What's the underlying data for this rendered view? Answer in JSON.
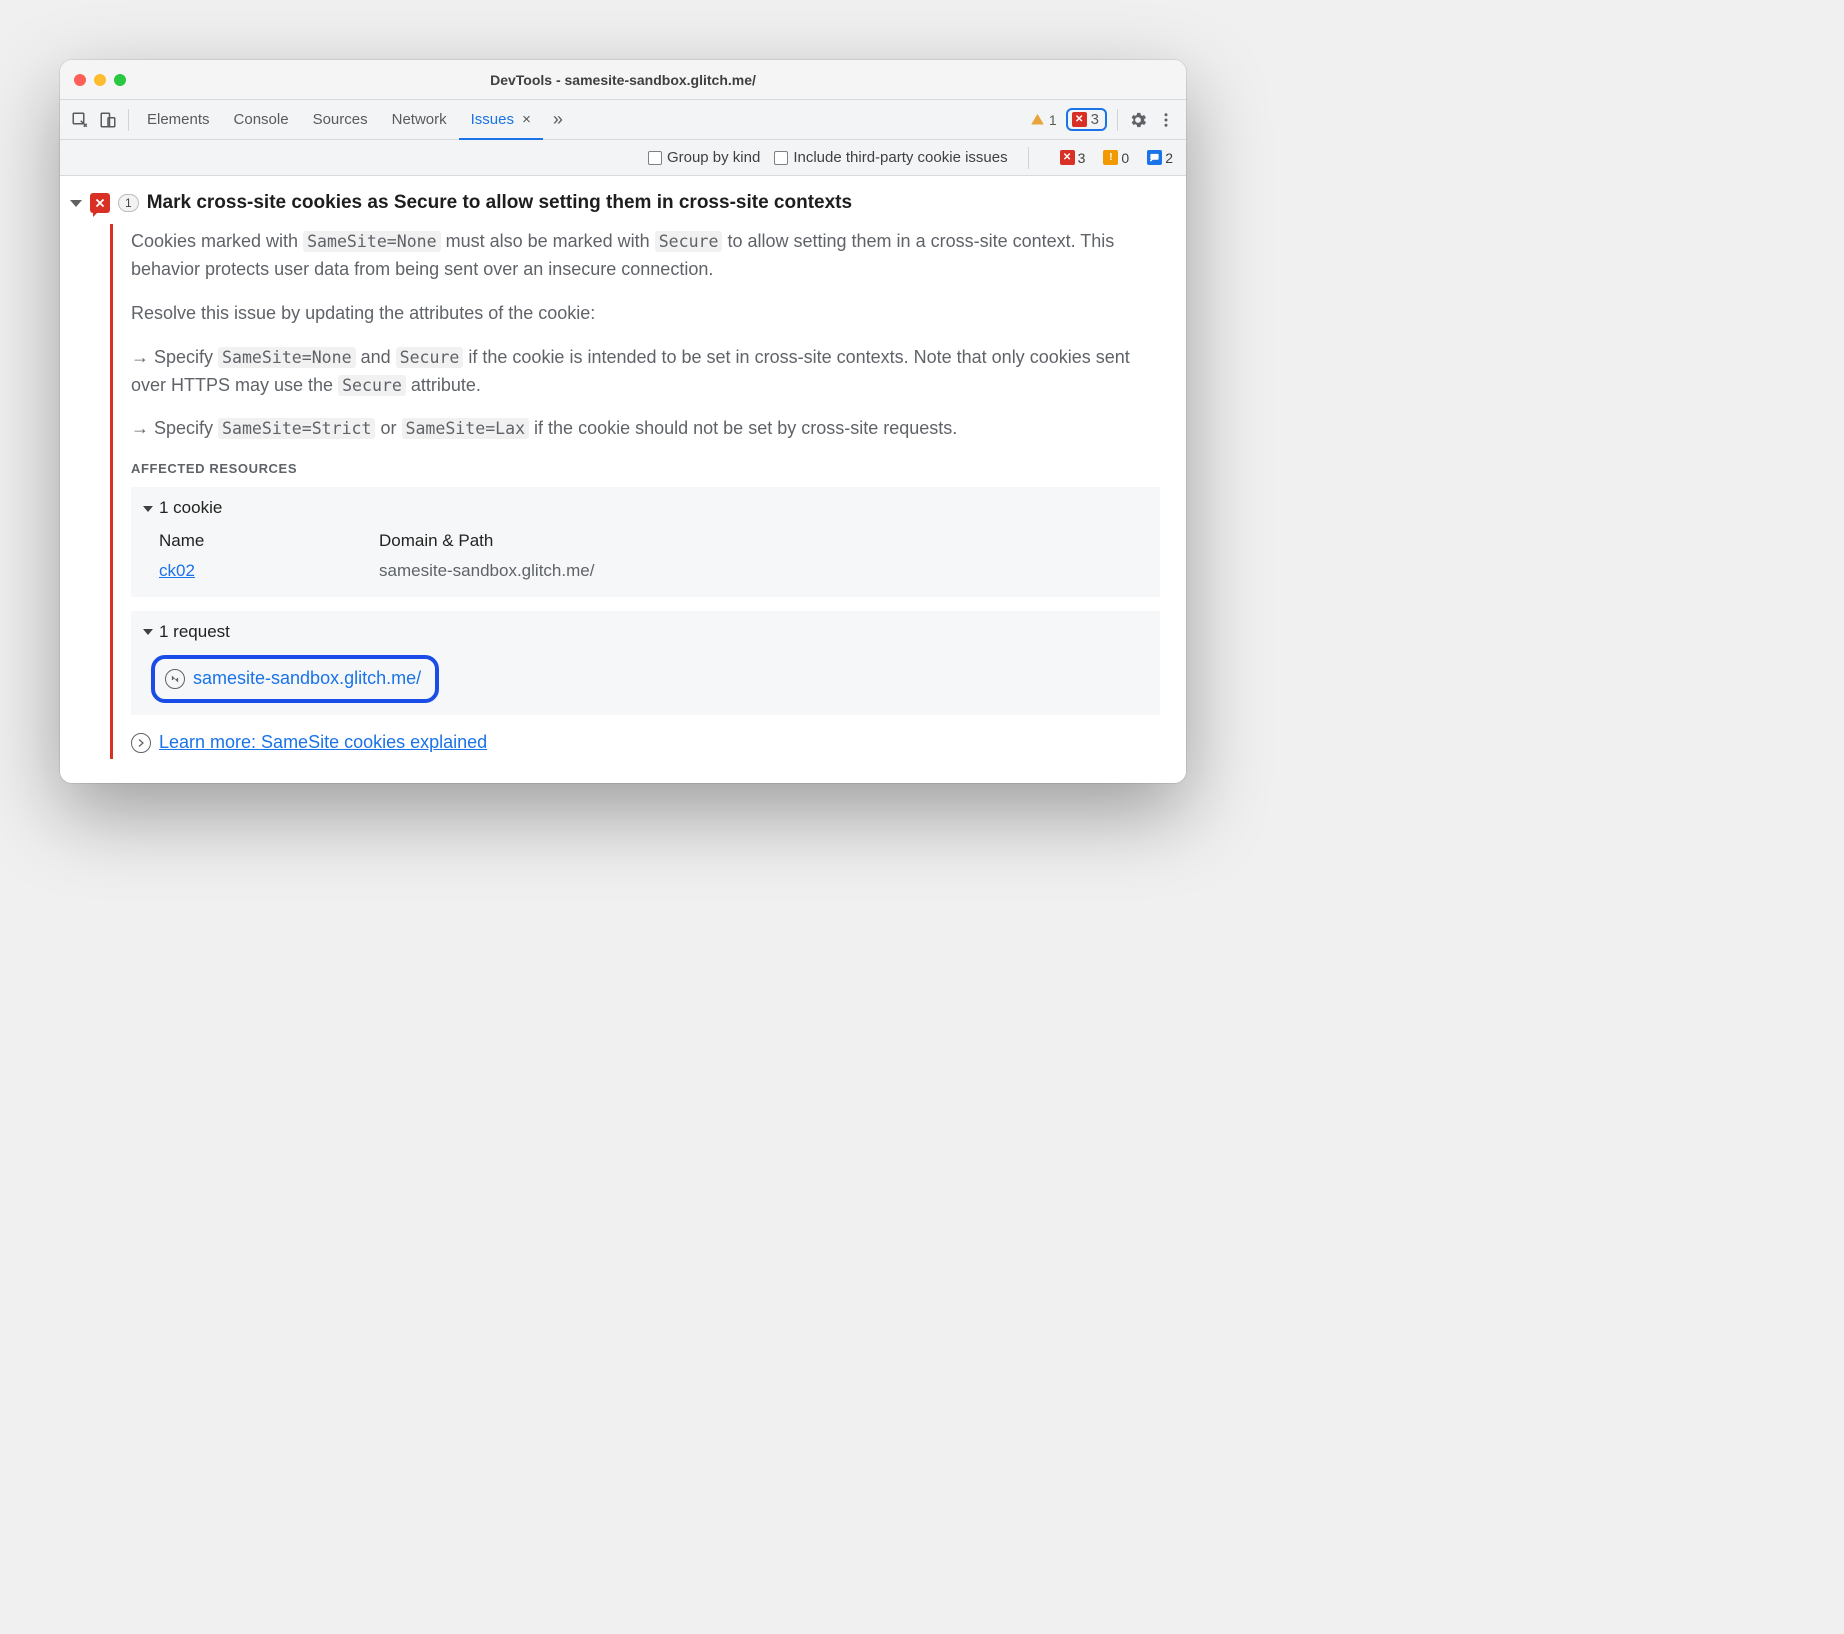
{
  "window": {
    "title": "DevTools - samesite-sandbox.glitch.me/"
  },
  "toolbar": {
    "tabs": [
      "Elements",
      "Console",
      "Sources",
      "Network",
      "Issues"
    ],
    "activeTab": "Issues",
    "warnCount": "1",
    "errCount": "3"
  },
  "filter": {
    "groupByKind": "Group by kind",
    "thirdParty": "Include third-party cookie issues",
    "errors": "3",
    "warnings": "0",
    "info": "2"
  },
  "issue": {
    "count": "1",
    "title": "Mark cross-site cookies as Secure to allow setting them in cross-site contexts",
    "p1a": "Cookies marked with ",
    "p1code1": "SameSite=None",
    "p1b": " must also be marked with ",
    "p1code2": "Secure",
    "p1c": " to allow setting them in a cross-site context. This behavior protects user data from being sent over an insecure connection.",
    "p2": "Resolve this issue by updating the attributes of the cookie:",
    "b1a": "Specify ",
    "b1code1": "SameSite=None",
    "b1b": " and ",
    "b1code2": "Secure",
    "b1c": " if the cookie is intended to be set in cross-site contexts. Note that only cookies sent over HTTPS may use the ",
    "b1code3": "Secure",
    "b1d": " attribute.",
    "b2a": "Specify ",
    "b2code1": "SameSite=Strict",
    "b2b": " or ",
    "b2code2": "SameSite=Lax",
    "b2c": " if the cookie should not be set by cross-site requests.",
    "affectedLabel": "AFFECTED RESOURCES",
    "cookieSection": "1 cookie",
    "colName": "Name",
    "colDomain": "Domain & Path",
    "cookieName": "ck02",
    "cookieDomain": "samesite-sandbox.glitch.me/",
    "requestSection": "1 request",
    "requestUrl": "samesite-sandbox.glitch.me/",
    "learn": "Learn more: SameSite cookies explained"
  }
}
